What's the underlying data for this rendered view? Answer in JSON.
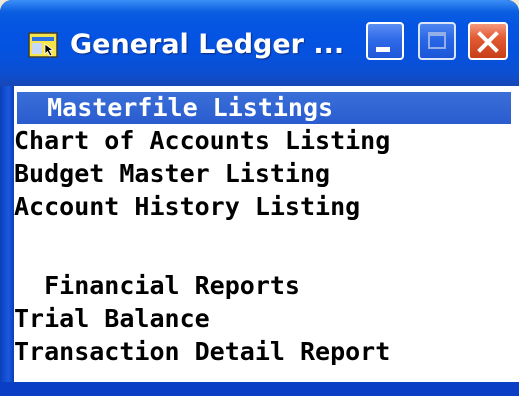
{
  "window": {
    "title": "General Ledger ...",
    "icon": "app-window-icon",
    "controls": {
      "minimize_icon": "minimize-icon",
      "maximize_icon": "maximize-icon",
      "close_icon": "close-icon"
    }
  },
  "colors": {
    "titlebar": "#0552e0",
    "selection": "#2a5ccf",
    "close_button": "#e35b33",
    "client_background": "#ffffff",
    "text": "#000000"
  },
  "menu": {
    "items": [
      {
        "label": "  Masterfile Listings",
        "selected": true
      },
      {
        "label": "Chart of Accounts Listing",
        "selected": false
      },
      {
        "label": "Budget Master Listing",
        "selected": false
      },
      {
        "label": "Account History Listing",
        "selected": false
      },
      {
        "label": "",
        "selected": false
      },
      {
        "label": "  Financial Reports",
        "selected": false
      },
      {
        "label": "Trial Balance",
        "selected": false
      },
      {
        "label": "Transaction Detail Report",
        "selected": false
      }
    ]
  }
}
